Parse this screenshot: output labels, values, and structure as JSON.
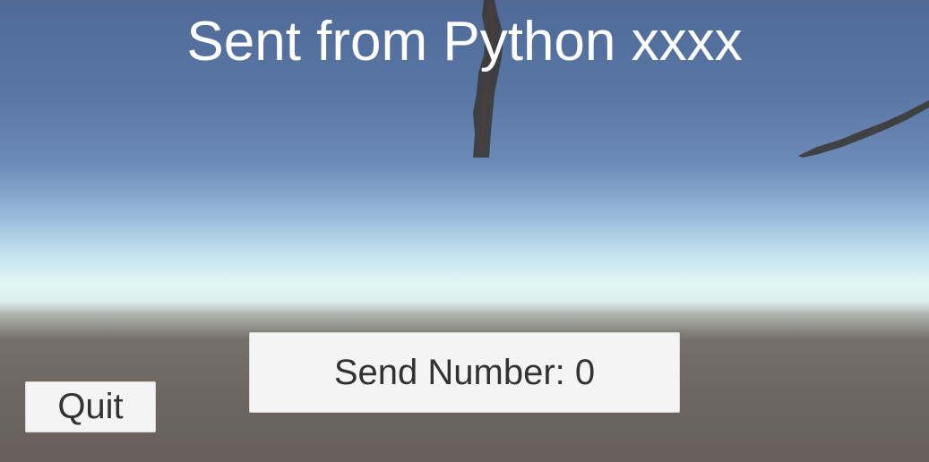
{
  "hud": {
    "title": "Sent from Python xxxx"
  },
  "buttons": {
    "send_label": "Send Number: 0",
    "quit_label": "Quit"
  },
  "colors": {
    "sky_top": "#4f6a96",
    "horizon": "#e3f6f5",
    "ground": "#6d6661",
    "button_bg": "#f4f4f4",
    "button_text": "#323232",
    "title_text": "#ffffff"
  }
}
